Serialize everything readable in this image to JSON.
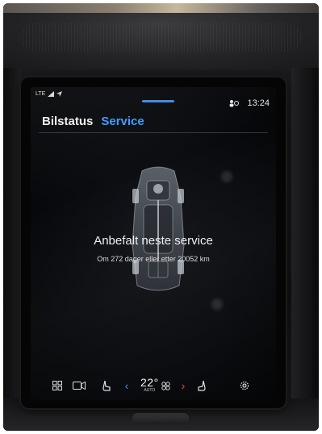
{
  "status_bar": {
    "network": "LTE",
    "time": "13:24"
  },
  "tabs": [
    {
      "label": "Bilstatus",
      "active": false
    },
    {
      "label": "Service",
      "active": true
    }
  ],
  "service": {
    "title": "Anbefalt neste service",
    "subtitle": "Om 272 dager eller etter 20052 km"
  },
  "climate": {
    "temperature": "22°",
    "mode": "AUTO"
  },
  "colors": {
    "accent": "#3d9bff",
    "temp_down": "#3d8be0",
    "temp_up": "#e0484a"
  },
  "icons": {
    "apps": "grid-icon",
    "camera": "camera-icon",
    "seat_left": "seat-heat-icon",
    "fan": "fan-icon",
    "seat_right": "seat-heat-icon",
    "settings": "gear-icon",
    "user": "user-icon",
    "signal": "signal-icon"
  }
}
